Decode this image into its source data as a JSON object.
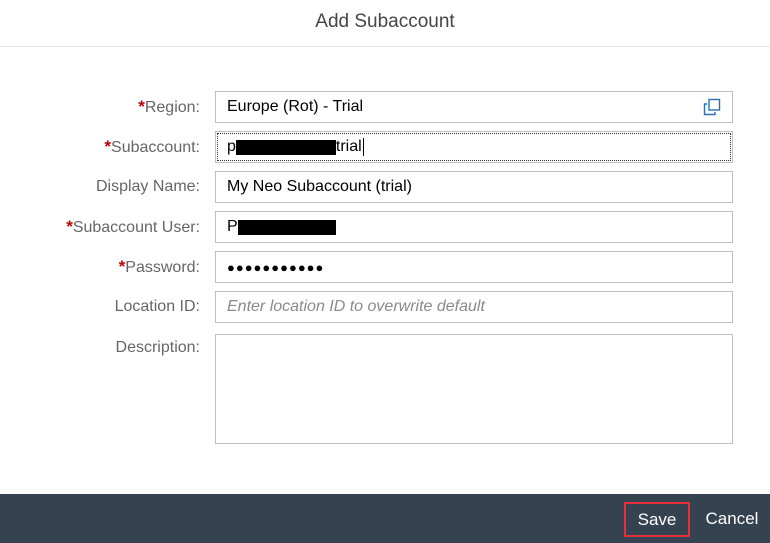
{
  "dialog": {
    "title": "Add Subaccount"
  },
  "form": {
    "required_marker": "*",
    "region": {
      "label": "Region:",
      "value": "Europe (Rot) - Trial",
      "icon": "value-help-icon"
    },
    "subaccount": {
      "label": "Subaccount:",
      "value_prefix": "p",
      "value_suffix": "trial"
    },
    "display_name": {
      "label": "Display Name:",
      "value": "My Neo Subaccount (trial)"
    },
    "subaccount_user": {
      "label": "Subaccount User:",
      "value_prefix": "P"
    },
    "password": {
      "label": "Password:",
      "value": "●●●●●●●●●●●"
    },
    "location_id": {
      "label": "Location ID:",
      "placeholder": "Enter location ID to overwrite default"
    },
    "description": {
      "label": "Description:",
      "value": ""
    }
  },
  "footer": {
    "save_label": "Save",
    "cancel_label": "Cancel"
  },
  "colors": {
    "footer_bg": "#354250",
    "required": "#bb0000",
    "save_highlight": "#e3303b"
  }
}
